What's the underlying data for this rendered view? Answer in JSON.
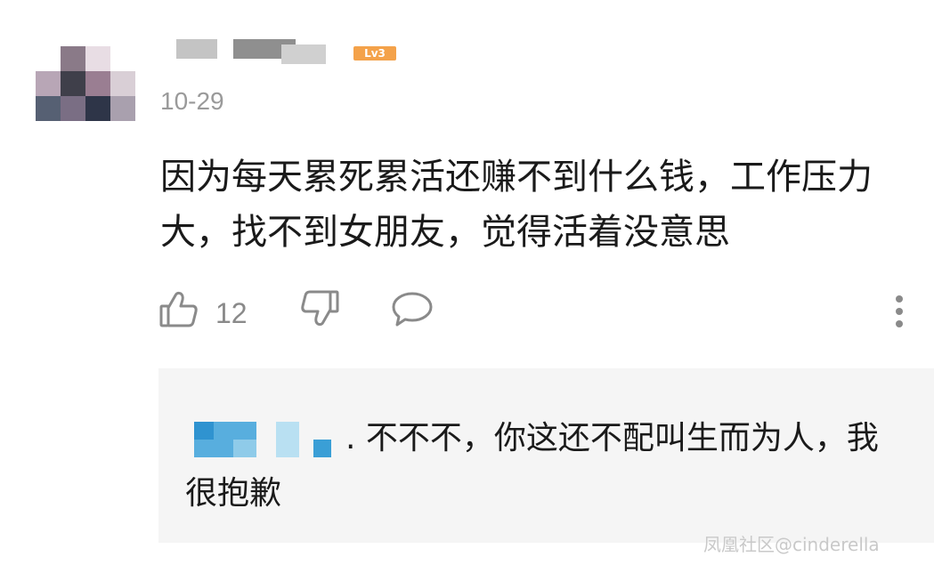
{
  "comment": {
    "date": "10-29",
    "level_badge": "Lv3",
    "text": "因为每天累死累活还赚不到什么钱，工作压力大，找不到女朋友，觉得活着没意思",
    "like_count": "12"
  },
  "actions": {
    "like_icon": "thumbs-up-icon",
    "dislike_icon": "thumbs-down-icon",
    "reply_icon": "comment-bubble-icon",
    "more_icon": "more-vertical-icon"
  },
  "reply": {
    "text": ". 不不不，你这还不配叫生而为人，我很抱歉"
  },
  "watermark": "凤凰社区@cinderella",
  "colors": {
    "badge": "#f4a24a",
    "reply_bg": "#f5f5f5",
    "muted": "#9a9a9a",
    "reply_user_blue": "#3a9fd6"
  }
}
